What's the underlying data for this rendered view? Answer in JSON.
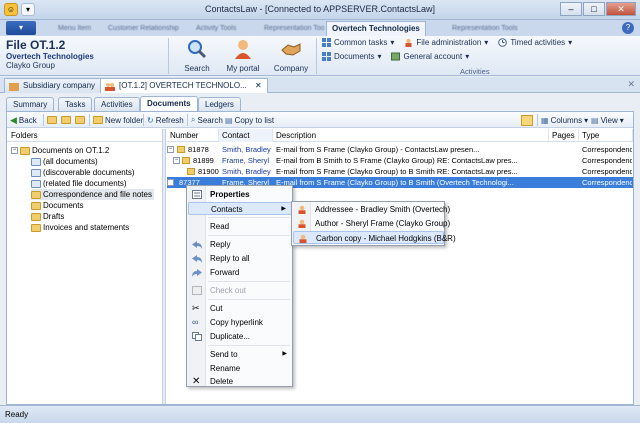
{
  "window": {
    "title": "ContactsLaw - [Connected to APPSERVER.ContactsLaw]"
  },
  "ribbon_tabs": {
    "active": "Overtech Technologies",
    "blurred": [
      "Menu Item",
      "Customer Relationship",
      "Activity Tools",
      "Representation Tools",
      "Representation Tools"
    ]
  },
  "file": {
    "title": "File OT.1.2",
    "company": "Overtech Technologies",
    "group": "Clayko Group"
  },
  "ribbon_buttons": {
    "search": "Search",
    "portal": "My portal",
    "company": "Company"
  },
  "ribbon_small": {
    "common_tasks": "Common tasks",
    "file_admin": "File administration",
    "timed_activities": "Timed activities",
    "documents": "Documents",
    "general_account": "General account",
    "group_label": "Activities"
  },
  "doc_tabs": [
    "Subsidiary company",
    "[OT.1.2] OVERTECH TECHNOLO..."
  ],
  "sub_tabs": [
    "Summary",
    "Tasks",
    "Activities",
    "Documents",
    "Ledgers"
  ],
  "toolbar": {
    "back": "Back",
    "new_folder": "New folder",
    "refresh": "Refresh",
    "search": "Search",
    "copy_to_list": "Copy to list",
    "columns": "Columns",
    "view": "View"
  },
  "folders": {
    "header": "Folders",
    "root": "Documents on OT.1.2",
    "items": [
      "(all documents)",
      "(discoverable documents)",
      "(related file documents)",
      "Correspondence and file notes",
      "Documents",
      "Drafts",
      "Invoices and statements"
    ]
  },
  "grid": {
    "columns": [
      "Number",
      "Contact",
      "Description",
      "Pages",
      "Type"
    ],
    "rows": [
      {
        "number": "81878",
        "contact": "Smith, Bradley",
        "description": "E-mail from S Frame (Clayko Group) - ContactsLaw presen...",
        "pages": "",
        "type": "Correspondence"
      },
      {
        "number": "81899",
        "contact": "Frame, Sheryl",
        "description": "E-mail from B Smith to S Frame (Clayko Group) RE: ContactsLaw pres...",
        "pages": "",
        "type": "Correspondence"
      },
      {
        "number": "81900",
        "contact": "Smith, Bradley",
        "description": "E-mail from S Frame (Clayko Group) to B Smith RE: ContactsLaw pres...",
        "pages": "",
        "type": "Correspondence"
      },
      {
        "number": "87377",
        "contact": "Frame, Sheryl",
        "description": "E-mail from S Frame (Clayko Group) to B Smith (Overtech Technologi...",
        "pages": "",
        "type": "Correspondence"
      }
    ]
  },
  "context_menu": {
    "items": [
      "Properties",
      "Contacts",
      "Read",
      "Reply",
      "Reply to all",
      "Forward",
      "Check out",
      "Cut",
      "Copy hyperlink",
      "Duplicate...",
      "Send to",
      "Rename",
      "Delete"
    ]
  },
  "contacts_submenu": {
    "items": [
      "Addressee - Bradley Smith (Overtech)",
      "Author - Sheryl Frame (Clayko Group)",
      "Carbon copy - Michael Hodgkins (B&R)"
    ]
  },
  "status": {
    "text": "Ready"
  }
}
